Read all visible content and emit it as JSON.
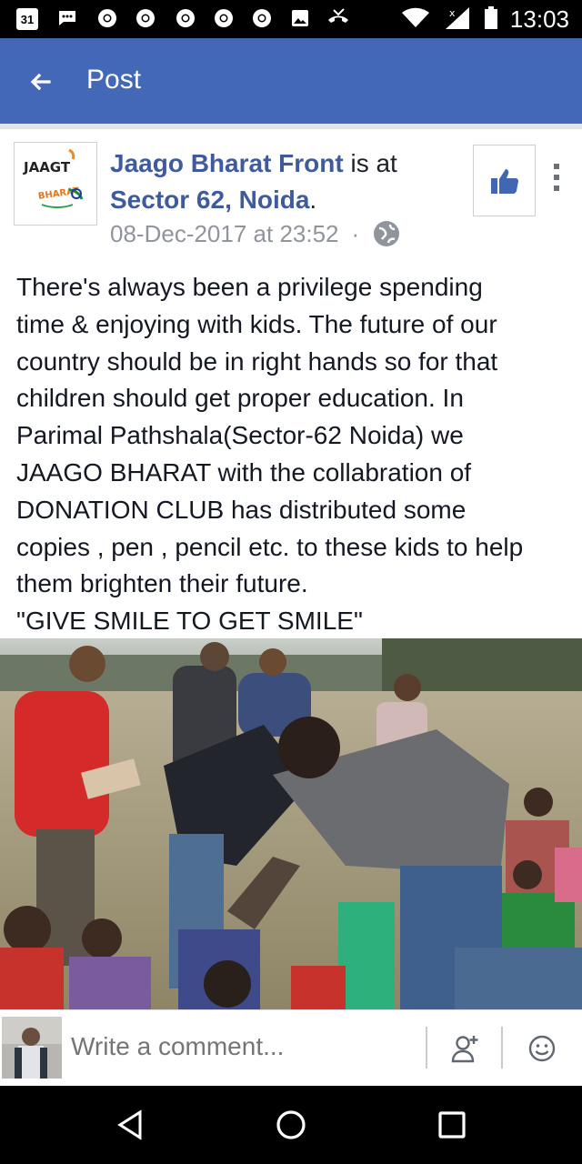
{
  "status_bar": {
    "calendar_day": "31",
    "time": "13:03",
    "icons": [
      "calendar-icon",
      "chat-bubble-icon",
      "chrome-icon",
      "chrome-icon",
      "chrome-icon",
      "chrome-icon",
      "chrome-icon",
      "gallery-icon",
      "missed-call-icon",
      "wifi-icon",
      "signal-icon",
      "battery-icon"
    ]
  },
  "header": {
    "title": "Post",
    "back_icon": "arrow-left-icon",
    "background": "#4468b8"
  },
  "post": {
    "logo_text_top": "JAAGT",
    "logo_text_bottom": "BHARAT",
    "author": "Jaago Bharat Front",
    "connector": " is at",
    "location": "Sector 62, Noida",
    "location_suffix": ".",
    "timestamp": "08-Dec-2017 at 23:52",
    "separator": "·",
    "privacy_icon": "globe-icon",
    "like_page_icon": "thumbs-up-icon",
    "menu_icon": "more-vertical-icon",
    "text_lines": [
      "There's always been a privilege spending",
      "time & enjoying with kids. The future of our",
      "country should be in right hands so for that",
      "children should get proper education. In",
      "Parimal Pathshala(Sector-62 Noida) we",
      "JAAGO BHARAT with the collabration of",
      "DONATION CLUB has distributed some",
      "copies , pen , pencil etc. to these kids to help",
      "them brighten their future.",
      "\"GIVE SMILE TO GET SMILE\""
    ],
    "link_color": "#3f5a9d"
  },
  "comment_bar": {
    "placeholder": "Write a comment...",
    "tag_icon": "add-friend-icon",
    "emoji_icon": "smiley-icon"
  },
  "nav_bar": {
    "icons": [
      "back-triangle-icon",
      "home-circle-icon",
      "recents-square-icon"
    ]
  }
}
